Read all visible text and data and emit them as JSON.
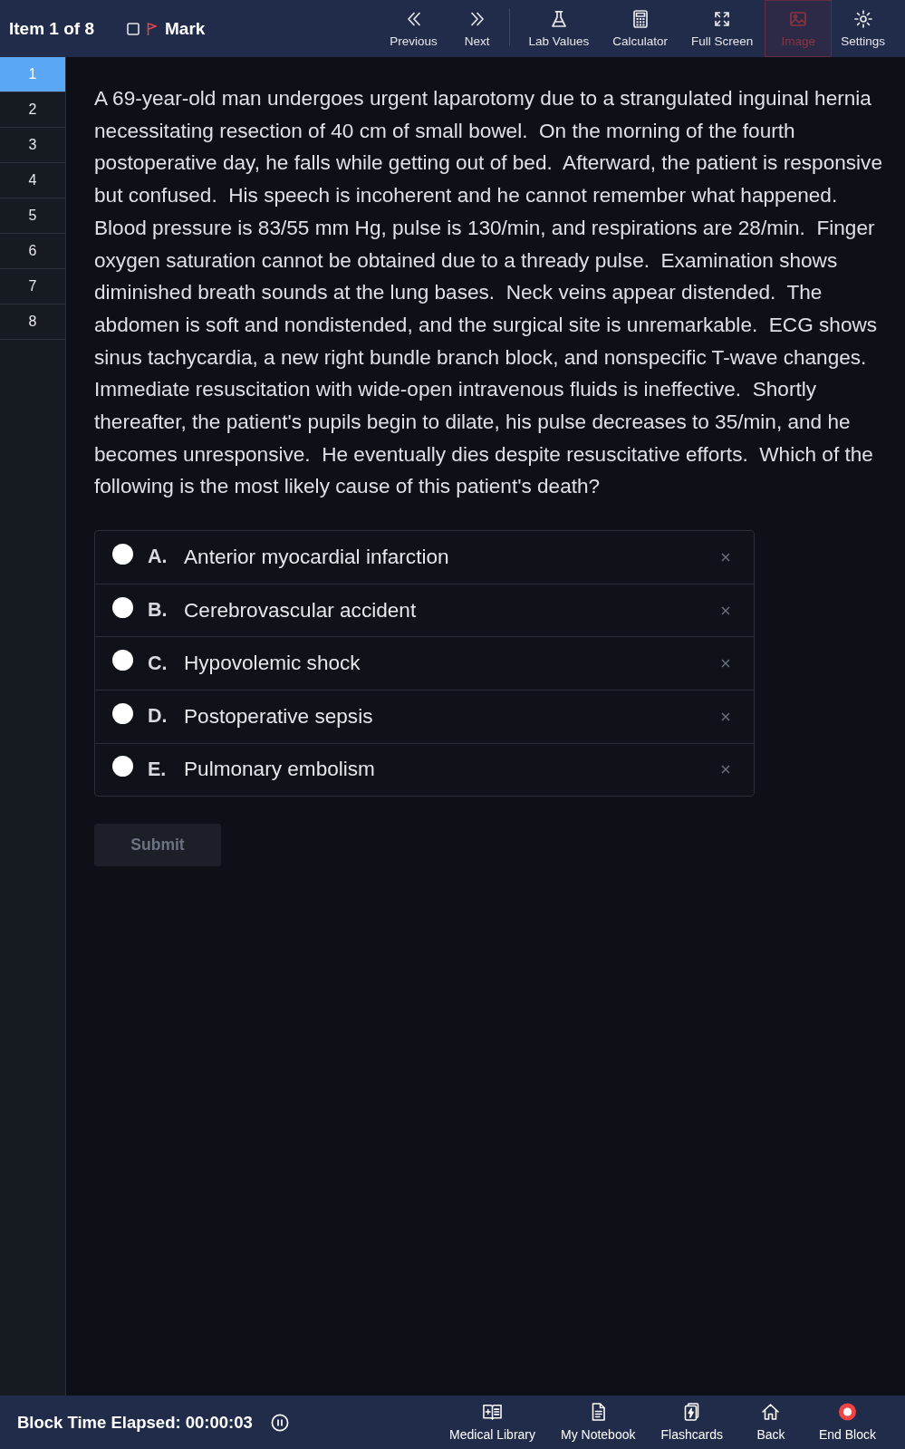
{
  "header": {
    "item_label": "Item 1 of 8",
    "mark": {
      "label": "Mark",
      "checked": false
    }
  },
  "nav": [
    {
      "kind": "previous",
      "label": "Previous",
      "disabled": false
    },
    {
      "kind": "next",
      "label": "Next",
      "disabled": false
    }
  ],
  "tools": [
    {
      "kind": "lab",
      "label": "Lab Values",
      "disabled": false
    },
    {
      "kind": "calculator",
      "label": "Calculator",
      "disabled": false
    },
    {
      "kind": "fullscreen",
      "label": "Full Screen",
      "disabled": false
    },
    {
      "kind": "image",
      "label": "Image",
      "disabled": true
    },
    {
      "kind": "settings",
      "label": "Settings",
      "disabled": false
    }
  ],
  "sidebar": {
    "items": [
      {
        "label": "1",
        "selected": true
      },
      {
        "label": "2",
        "selected": false
      },
      {
        "label": "3",
        "selected": false
      },
      {
        "label": "4",
        "selected": false
      },
      {
        "label": "5",
        "selected": false
      },
      {
        "label": "6",
        "selected": false
      },
      {
        "label": "7",
        "selected": false
      },
      {
        "label": "8",
        "selected": false
      }
    ]
  },
  "question": {
    "stem": "A 69-year-old man undergoes urgent laparotomy due to a strangulated inguinal hernia necessitating resection of 40 cm of small bowel.  On the morning of the fourth postoperative day, he falls while getting out of bed.  Afterward, the patient is responsive but confused.  His speech is incoherent and he cannot remember what happened.  Blood pressure is 83/55 mm Hg, pulse is 130/min, and respirations are 28/min.  Finger oxygen saturation cannot be obtained due to a thready pulse.  Examination shows diminished breath sounds at the lung bases.  Neck veins appear distended.  The abdomen is soft and nondistended, and the surgical site is unremarkable.  ECG shows sinus tachycardia, a new right bundle branch block, and nonspecific T-wave changes.  Immediate resuscitation with wide-open intravenous fluids is ineffective.  Shortly thereafter, the patient's pupils begin to dilate, his pulse decreases to 35/min, and he becomes unresponsive.  He eventually dies despite resuscitative efforts.  Which of the following is the most likely cause of this patient's death?"
  },
  "options": [
    {
      "letter": "A.",
      "text": "Anterior myocardial infarction",
      "selected": false
    },
    {
      "letter": "B.",
      "text": "Cerebrovascular accident",
      "selected": false
    },
    {
      "letter": "C.",
      "text": "Hypovolemic shock",
      "selected": false
    },
    {
      "letter": "D.",
      "text": "Postoperative sepsis",
      "selected": false
    },
    {
      "letter": "E.",
      "text": "Pulmonary embolism",
      "selected": false
    }
  ],
  "submit": {
    "label": "Submit",
    "disabled": true
  },
  "footer": {
    "timer": "Block Time Elapsed: 00:00:03",
    "tools": [
      {
        "kind": "library",
        "label": "Medical Library"
      },
      {
        "kind": "notebook",
        "label": "My Notebook"
      },
      {
        "kind": "flashcards",
        "label": "Flashcards"
      },
      {
        "kind": "back",
        "label": "Back"
      },
      {
        "kind": "end",
        "label": "End Block"
      }
    ]
  }
}
